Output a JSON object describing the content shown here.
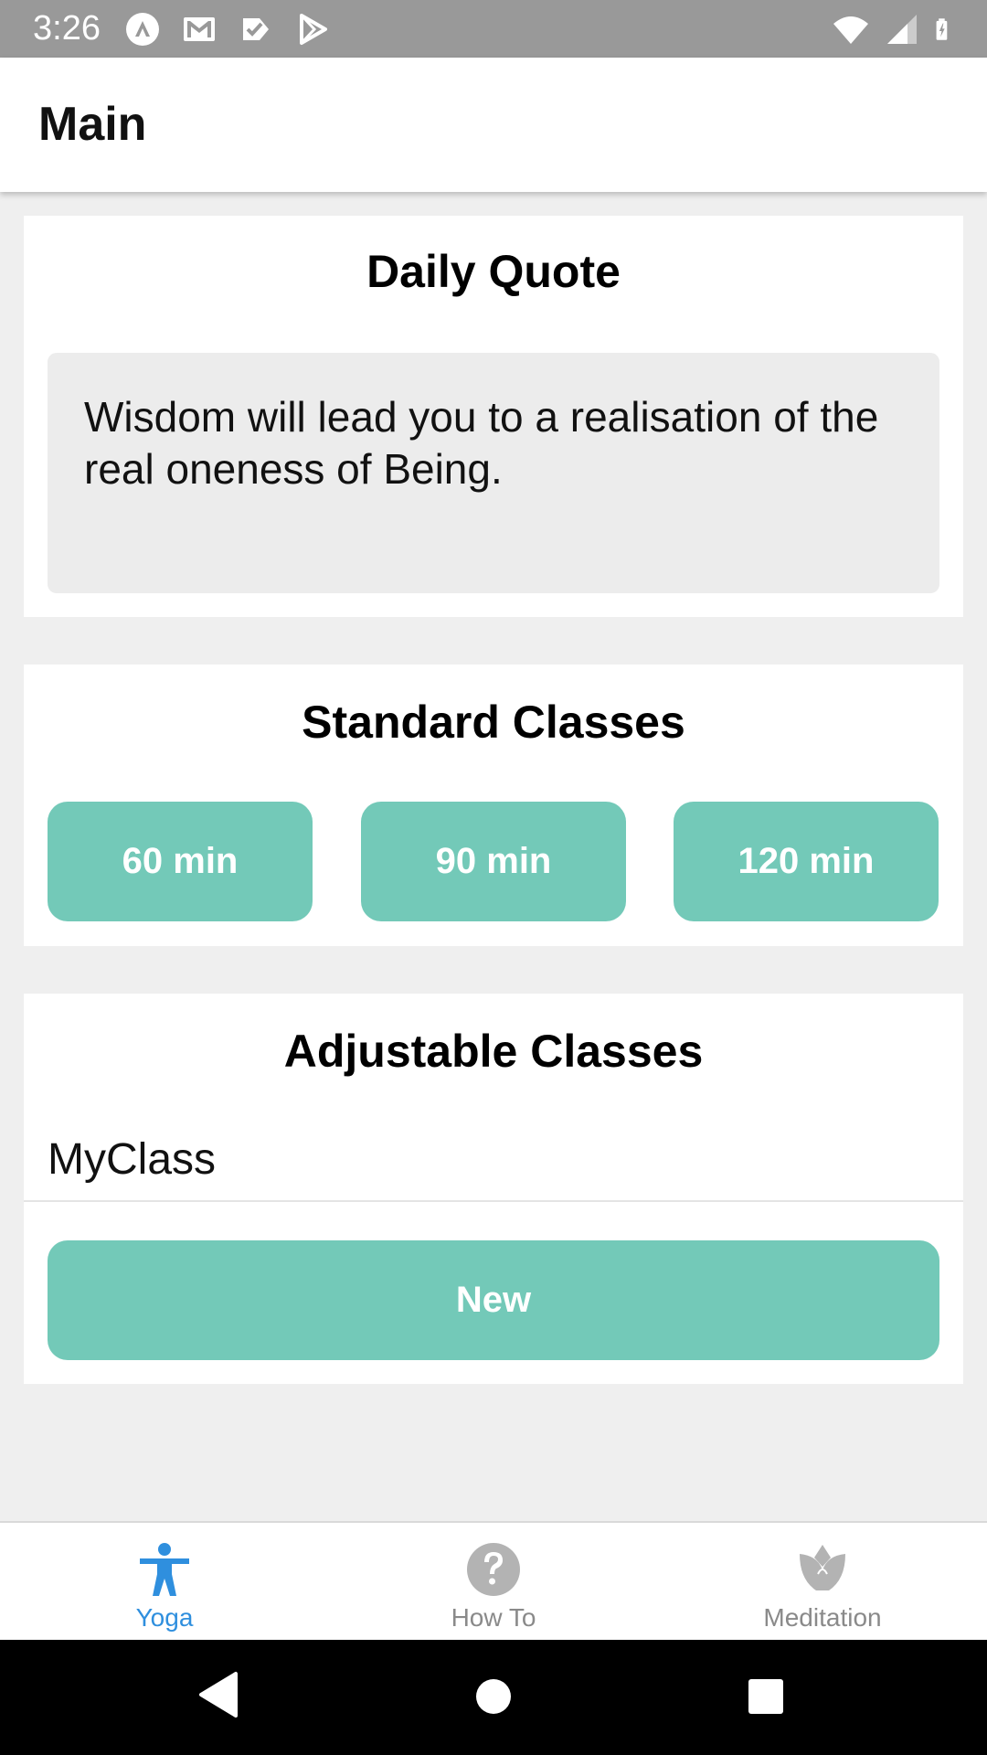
{
  "status_bar": {
    "time": "3:26",
    "left_icons": [
      "app-notification-icon",
      "gmail-icon",
      "check-notification-icon",
      "play-store-icon"
    ],
    "right_icons": [
      "wifi-icon",
      "cell-signal-icon",
      "battery-icon"
    ]
  },
  "app_bar": {
    "title": "Main"
  },
  "daily_quote": {
    "title": "Daily Quote",
    "text": "Wisdom will lead you to a realisation of the real oneness of Being."
  },
  "standard_classes": {
    "title": "Standard Classes",
    "buttons": [
      "60 min",
      "90 min",
      "120 min"
    ]
  },
  "adjustable_classes": {
    "title": "Adjustable Classes",
    "items": [
      "MyClass"
    ],
    "new_button": "New"
  },
  "bottom_nav": {
    "items": [
      {
        "label": "Yoga",
        "icon": "person-icon",
        "active": true
      },
      {
        "label": "How To",
        "icon": "help-circle-icon",
        "active": false
      },
      {
        "label": "Meditation",
        "icon": "lotus-icon",
        "active": false
      }
    ]
  },
  "colors": {
    "accent": "#73c9b8",
    "active_tab": "#2f8fde",
    "inactive_tab": "#8a8a8a",
    "status_bar": "#999999"
  }
}
